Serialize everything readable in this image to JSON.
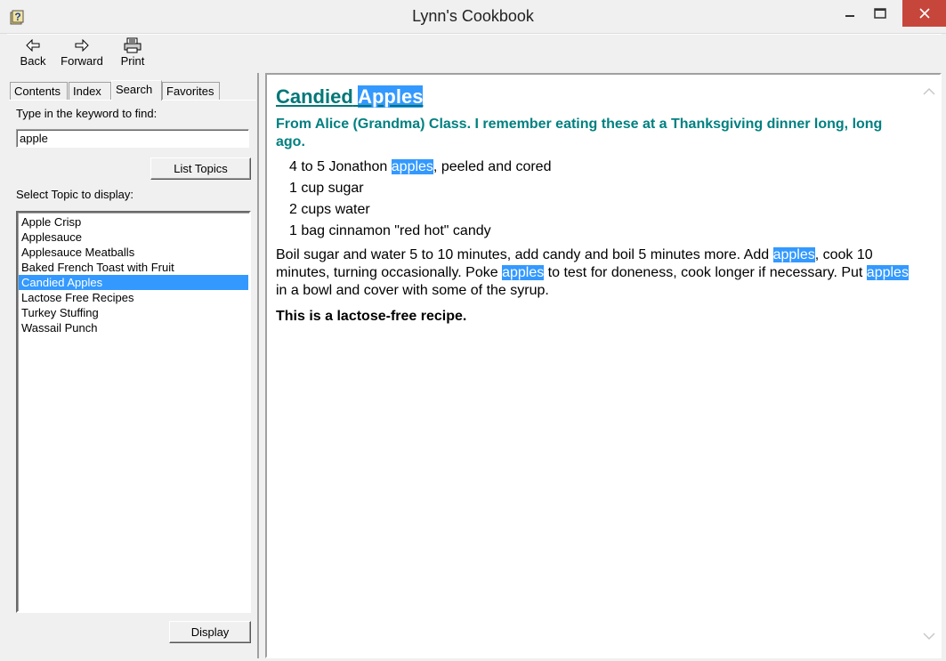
{
  "window": {
    "title": "Lynn's Cookbook"
  },
  "toolbar": {
    "back": "Back",
    "forward": "Forward",
    "print": "Print"
  },
  "tabs": {
    "contents": "Contents",
    "index": "Index",
    "search": "Search",
    "favorites": "Favorites"
  },
  "search": {
    "keyword_label": "Type in the keyword to find:",
    "keyword_value": "apple",
    "list_topics_button": "List Topics",
    "topic_label": "Select Topic to display:",
    "topics": [
      "Apple Crisp",
      "Applesauce",
      "Applesauce Meatballs",
      "Baked French Toast with Fruit",
      "Candied Apples",
      "Lactose Free Recipes",
      "Turkey Stuffing",
      "Wassail Punch"
    ],
    "selected_topic": "Candied Apples",
    "display_button": "Display"
  },
  "doc": {
    "title_a": "Candied",
    "title_b": "Apples",
    "subtitle": "From Alice (Grandma) Class. I remember eating these at a Thanksgiving dinner long, long ago.",
    "ingredient1_pre": "4 to 5 Jonathon",
    "ingredient1_hl": "apples",
    "ingredient1_post": ", peeled and cored",
    "ingredient2": "1 cup sugar",
    "ingredient3": "2 cups water",
    "ingredient4": "1 bag cinnamon \"red hot\" candy",
    "para_1": "Boil sugar and water 5 to 10 minutes, add candy and boil 5 minutes more. Add",
    "para_hl1": "apples",
    "para_2": ", cook 10 minutes, turning occasionally. Poke",
    "para_hl2": "apples",
    "para_3": "to test for doneness, cook longer if necessary. Put",
    "para_hl3": "apples",
    "para_4": "in a bowl and cover with some of the syrup.",
    "note": "This is a lactose-free recipe."
  },
  "colors": {
    "highlight": "#3399ff",
    "heading": "#007777",
    "close_button": "#c7463c"
  }
}
